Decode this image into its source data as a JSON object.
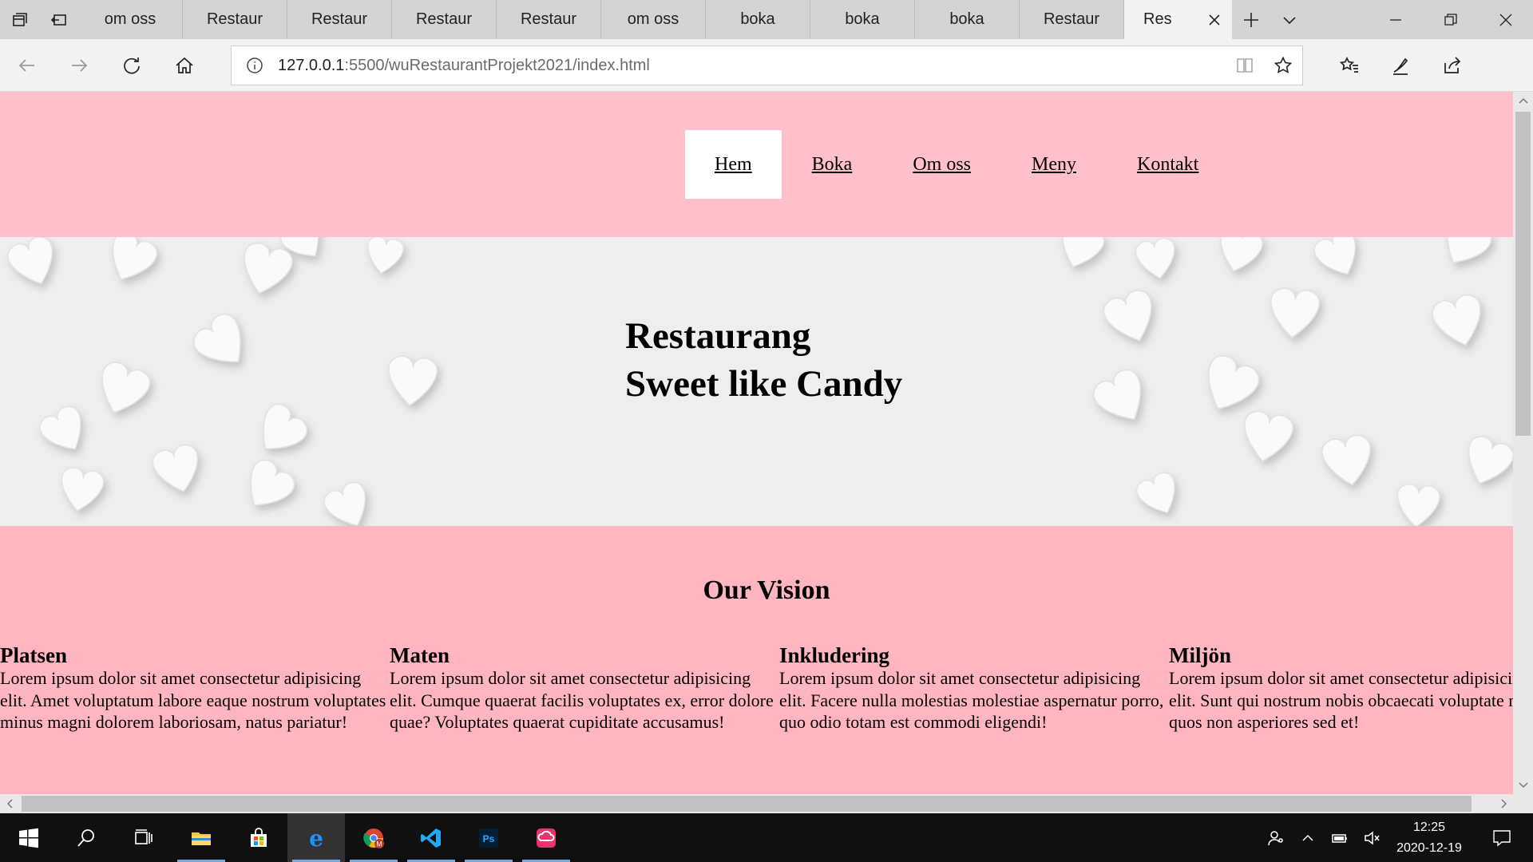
{
  "browser": {
    "tabs": [
      {
        "label": "om oss"
      },
      {
        "label": "Restaur"
      },
      {
        "label": "Restaur"
      },
      {
        "label": "Restaur"
      },
      {
        "label": "Restaur"
      },
      {
        "label": "om oss"
      },
      {
        "label": "boka"
      },
      {
        "label": "boka"
      },
      {
        "label": "boka"
      },
      {
        "label": "Restaur"
      }
    ],
    "active_tab": {
      "label": "Res"
    },
    "url_host": "127.0.0.1",
    "url_path": ":5500/wuRestaurantProjekt2021/index.html"
  },
  "site": {
    "nav": [
      {
        "label": "Hem",
        "active": true
      },
      {
        "label": "Boka"
      },
      {
        "label": "Om oss"
      },
      {
        "label": "Meny"
      },
      {
        "label": "Kontakt"
      }
    ],
    "hero": {
      "line1": "Restaurang",
      "line2": "Sweet like Candy"
    },
    "vision": {
      "title": "Our Vision",
      "columns": [
        {
          "heading": "Platsen",
          "text": "Lorem ipsum dolor sit amet consectetur adipisicing elit. Amet voluptatum labore eaque nostrum voluptates minus magni dolorem laboriosam, natus pariatur!"
        },
        {
          "heading": "Maten",
          "text": "Lorem ipsum dolor sit amet consectetur adipisicing elit. Cumque quaerat facilis voluptates ex, error dolore quae? Voluptates quaerat cupiditate accusamus!"
        },
        {
          "heading": "Inkludering",
          "text": "Lorem ipsum dolor sit amet consectetur adipisicing elit. Facere nulla molestias molestiae aspernatur porro, quo odio totam est commodi eligendi!"
        },
        {
          "heading": "Miljön",
          "text": "Lorem ipsum dolor sit amet consectetur adipisicing elit. Sunt qui nostrum nobis obcaecati voluptate nam quos non asperiores sed et!"
        }
      ]
    }
  },
  "taskbar": {
    "time": "12:25",
    "date": "2020-12-19"
  },
  "colors": {
    "header_pink": "#ffc0cb",
    "vision_pink": "#ffb6c1",
    "hero_bg": "#eeeeee"
  }
}
